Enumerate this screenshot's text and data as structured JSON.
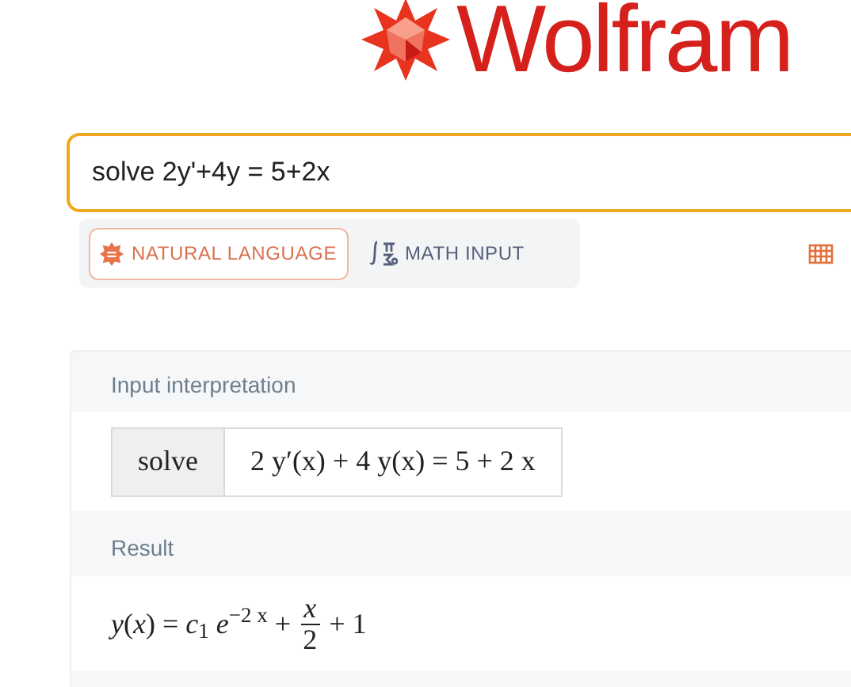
{
  "logo": {
    "text": "Wolfram"
  },
  "search": {
    "value": "solve 2y'+4y = 5+2x"
  },
  "input_modes": [
    {
      "label": "NATURAL LANGUAGE",
      "kind": "natural",
      "selected": true
    },
    {
      "label": "MATH INPUT",
      "kind": "math",
      "selected": false
    }
  ],
  "pods": [
    {
      "title": "Input interpretation",
      "kind": "table",
      "cells": [
        "solve",
        "2 y′(x) + 4 y(x) = 5 + 2 x"
      ]
    },
    {
      "title": "Result",
      "kind": "formula",
      "before": "*y*(*x*) = *c*$_{1}$ *e*$^{−2 x}$ +",
      "numerator": "x",
      "denominator": "2",
      "after": "+ 1"
    }
  ]
}
